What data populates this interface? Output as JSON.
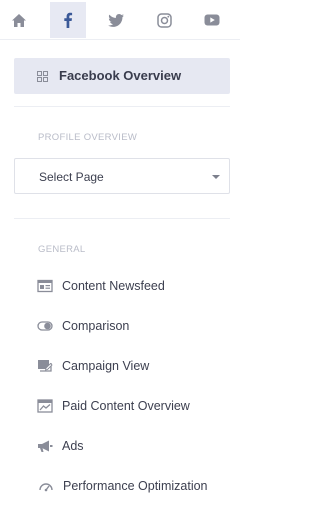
{
  "social_tabs": [
    {
      "name": "home",
      "icon": "home-icon",
      "active": false
    },
    {
      "name": "facebook",
      "icon": "facebook-icon",
      "active": true
    },
    {
      "name": "twitter",
      "icon": "twitter-icon",
      "active": false
    },
    {
      "name": "instagram",
      "icon": "instagram-icon",
      "active": false
    },
    {
      "name": "youtube",
      "icon": "youtube-icon",
      "active": false
    }
  ],
  "overview": {
    "label": "Facebook Overview",
    "icon": "grid-icon"
  },
  "profile_section": {
    "title": "PROFILE OVERVIEW",
    "select_value": "Select Page"
  },
  "general_section": {
    "title": "GENERAL",
    "items": [
      {
        "label": "Content Newsfeed",
        "icon": "newsfeed-icon"
      },
      {
        "label": "Comparison",
        "icon": "comparison-icon"
      },
      {
        "label": "Campaign View",
        "icon": "campaign-icon"
      },
      {
        "label": "Paid Content Overview",
        "icon": "paid-content-icon"
      },
      {
        "label": "Ads",
        "icon": "megaphone-icon"
      },
      {
        "label": "Performance Optimization",
        "icon": "gauge-icon"
      }
    ]
  },
  "colors": {
    "active_bg": "#e7e9f3",
    "facebook_blue": "#3b5998",
    "icon_gray": "#8a8d99",
    "text": "#3c3f4f",
    "section_title": "#b9bcc8"
  }
}
